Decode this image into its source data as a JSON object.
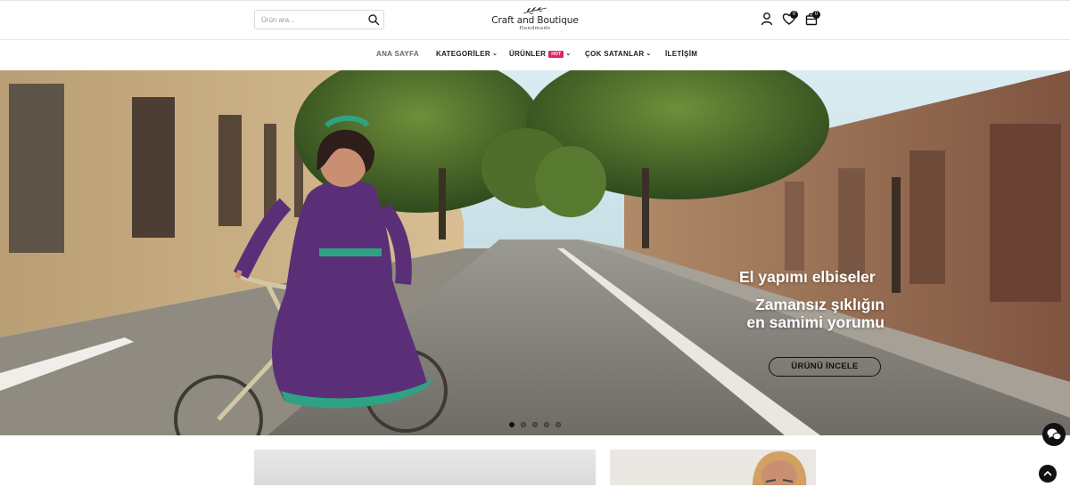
{
  "header": {
    "search_placeholder": "Ürün ara...",
    "logo_title": "Craft and Boutique",
    "logo_subtitle": "Handmade",
    "wishlist_count": "0",
    "cart_count": "0"
  },
  "nav": {
    "items": [
      {
        "label": "ANA SAYFA"
      },
      {
        "label": "KATEGORİLER"
      },
      {
        "label": "ÜRÜNLER",
        "badge": "HOT"
      },
      {
        "label": "ÇOK SATANLAR"
      },
      {
        "label": "İLETİŞİM"
      }
    ]
  },
  "hero": {
    "heading_line1": "El yapımı elbiseler",
    "heading_line2": "Zamansız şıklığın en samimi yorumu",
    "cta_label": "ÜRÜNÜ İNCELE",
    "slide_count": 5,
    "active_slide": 1
  },
  "icons": {
    "search": "search-icon",
    "account": "user-icon",
    "wishlist": "heart-icon",
    "cart": "shopping-bag-icon",
    "chat": "chat-icon",
    "back_to_top": "chevron-up-icon"
  }
}
